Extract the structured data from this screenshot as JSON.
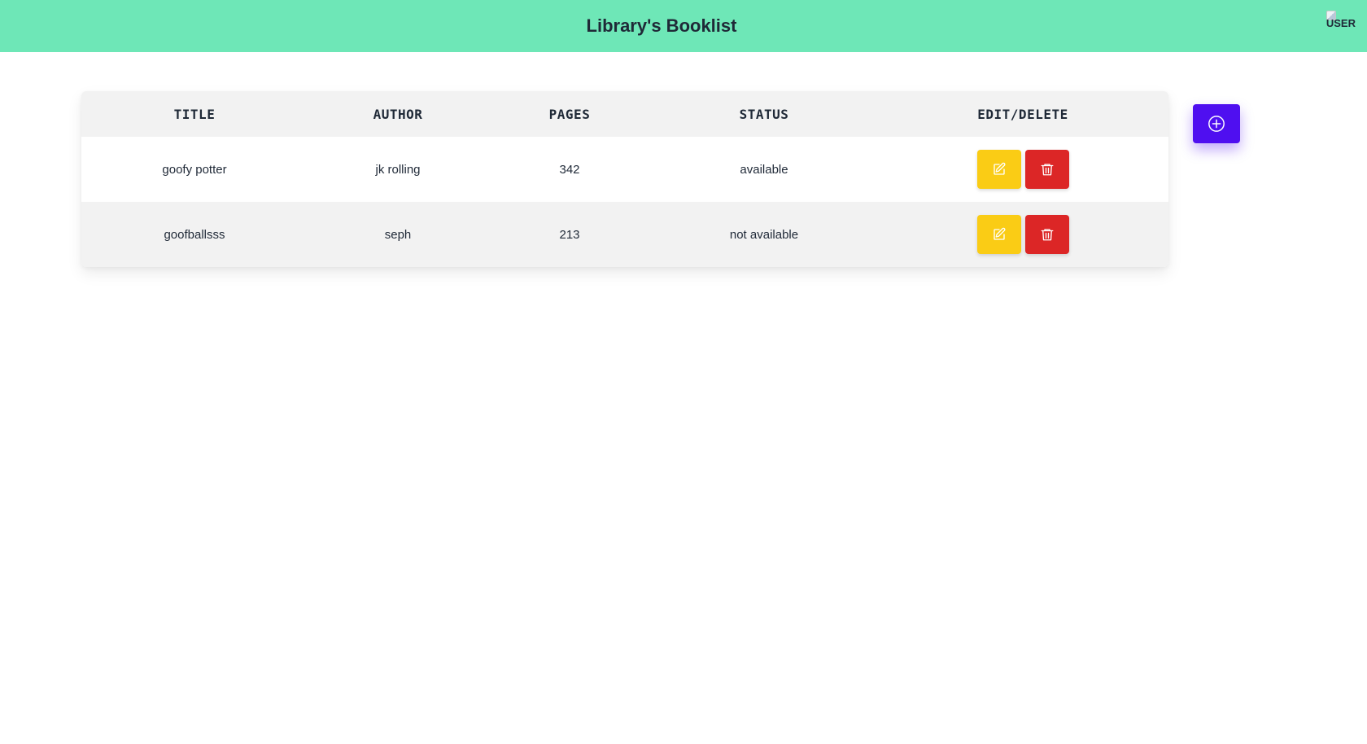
{
  "header": {
    "title": "Library's Booklist",
    "avatar_alt": "USER"
  },
  "table": {
    "columns": [
      "TITLE",
      "AUTHOR",
      "PAGES",
      "STATUS",
      "EDIT/DELETE"
    ],
    "rows": [
      {
        "title": "goofy potter",
        "author": "jk rolling",
        "pages": "342",
        "status": "available"
      },
      {
        "title": "goofballsss",
        "author": "seph",
        "pages": "213",
        "status": "not available"
      }
    ]
  },
  "icons": {
    "edit": "pencil-icon",
    "delete": "trash-icon",
    "add": "plus-circle-icon"
  },
  "colors": {
    "header_bg": "#6ee7b7",
    "edit_button": "#facc15",
    "delete_button": "#dc2626",
    "add_button": "#4f0ff0"
  }
}
